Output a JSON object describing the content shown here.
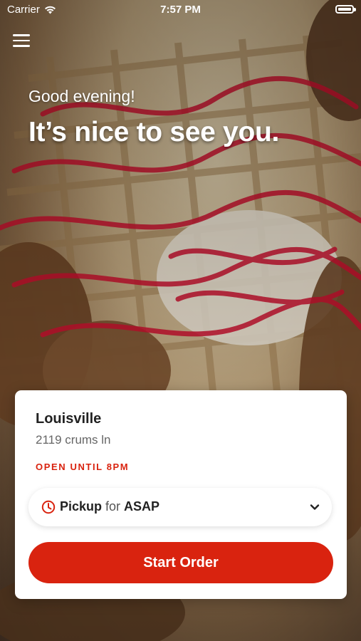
{
  "status_bar": {
    "carrier": "Carrier",
    "time": "7:57 PM"
  },
  "hero": {
    "greeting": "Good evening!",
    "headline": "It’s nice to see you."
  },
  "location": {
    "name": "Louisville",
    "address": "2119 crums ln",
    "hours": "OPEN UNTIL 8PM"
  },
  "order_mode": {
    "mode": "Pickup",
    "connector": "for",
    "time": "ASAP"
  },
  "actions": {
    "start_order_label": "Start Order"
  },
  "colors": {
    "accent": "#d9230f",
    "card": "#ffffff"
  },
  "icons": {
    "menu": "hamburger-menu-icon",
    "clock": "clock-icon",
    "chevron": "chevron-down-icon",
    "wifi": "wifi-icon",
    "battery": "battery-icon"
  }
}
